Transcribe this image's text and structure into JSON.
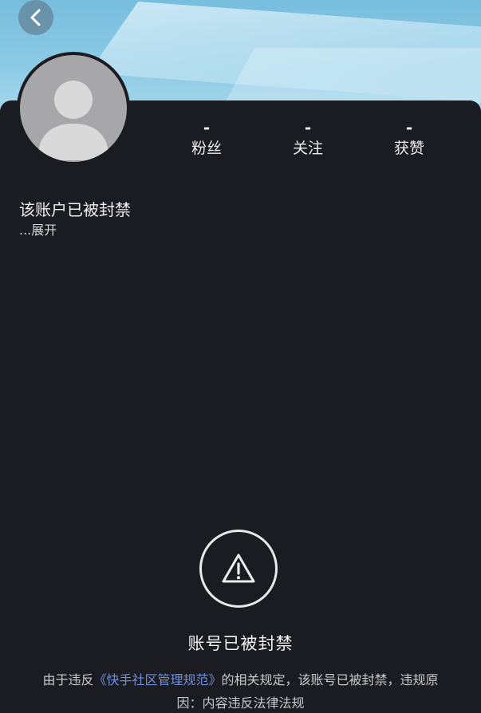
{
  "header": {
    "back_icon": "chevron-left-icon"
  },
  "profile": {
    "avatar_icon": "default-user-avatar-icon",
    "stats": [
      {
        "value": "-",
        "label": "粉丝"
      },
      {
        "value": "-",
        "label": "关注"
      },
      {
        "value": "-",
        "label": "获赞"
      }
    ],
    "bio": "该账户已被封禁",
    "expand_label": "...展开"
  },
  "ban_notice": {
    "icon": "warning-triangle-icon",
    "title": "账号已被封禁",
    "text_before": "由于违反",
    "link_text": "《快手社区管理规范》",
    "text_after": "的相关规定，该账号已被封禁，违规原因：内容违反法律法规"
  },
  "colors": {
    "banner_sky": "#8ccbe5",
    "background": "#1b1b22",
    "link": "#6f8fd8",
    "avatar_gray": "#a7a7a9"
  }
}
